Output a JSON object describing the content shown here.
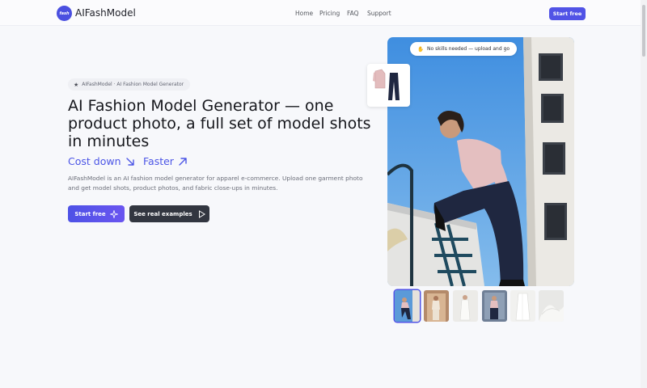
{
  "brand": {
    "name": "AIFashModel",
    "mark": "fash"
  },
  "nav": {
    "home": "Home",
    "pricing": "Pricing",
    "faq": "FAQ",
    "support": "Support"
  },
  "header_cta": "Start free",
  "hero": {
    "badge": "AIFashModel · AI Fashion Model Generator",
    "headline": "AI Fashion Model Generator — one product photo, a full set of model shots in minutes",
    "tag_cost": "Cost down",
    "tag_faster": "Faster",
    "description": "AIFashModel is an AI fashion model generator for apparel e-commerce. Upload one garment photo and get model shots, product photos, and fabric close-ups in minutes.",
    "primary_button": "Start free",
    "secondary_button": "See real examples",
    "pill_text": "No skills needed — upload and go"
  },
  "thumbnails": {
    "count": 6,
    "active_index": 0
  },
  "colors": {
    "accent": "#5153e6",
    "accent_text": "#4b55e6",
    "dark_button": "#323640"
  }
}
